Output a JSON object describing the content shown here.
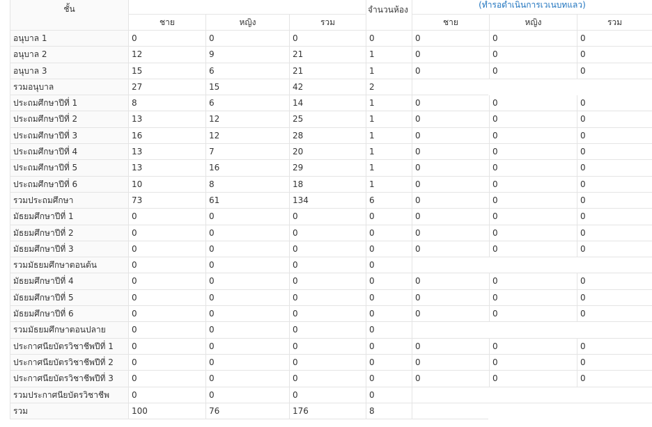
{
  "header": {
    "class_label": "ชั้น",
    "rooms_label": "จำนวนห้อง",
    "note": "(ทำรอดำเนินการเวเนบทแลว)",
    "students_cols": [
      "ชาย",
      "หญิง",
      "รวม"
    ],
    "waiting_cols": [
      "ชาย",
      "หญิง",
      "รวม"
    ]
  },
  "rows": [
    {
      "label": "อนุบาล 1",
      "m": "0",
      "f": "0",
      "t": "0",
      "rooms": "0",
      "w": [
        "0",
        "0",
        "0"
      ]
    },
    {
      "label": "อนุบาล 2",
      "m": "12",
      "f": "9",
      "t": "21",
      "rooms": "1",
      "w": [
        "0",
        "0",
        "0"
      ]
    },
    {
      "label": "อนุบาล 3",
      "m": "15",
      "f": "6",
      "t": "21",
      "rooms": "1",
      "w": [
        "0",
        "0",
        "0"
      ]
    },
    {
      "label": "รวมอนุบาล",
      "m": "27",
      "f": "15",
      "t": "42",
      "rooms": "2",
      "w": null
    },
    {
      "label": "ประถมศึกษาปีที่ 1",
      "m": "8",
      "f": "6",
      "t": "14",
      "rooms": "1",
      "w": [
        "0",
        "0",
        "0"
      ]
    },
    {
      "label": "ประถมศึกษาปีที่ 2",
      "m": "13",
      "f": "12",
      "t": "25",
      "rooms": "1",
      "w": [
        "0",
        "0",
        "0"
      ]
    },
    {
      "label": "ประถมศึกษาปีที่ 3",
      "m": "16",
      "f": "12",
      "t": "28",
      "rooms": "1",
      "w": [
        "0",
        "0",
        "0"
      ]
    },
    {
      "label": "ประถมศึกษาปีที่ 4",
      "m": "13",
      "f": "7",
      "t": "20",
      "rooms": "1",
      "w": [
        "0",
        "0",
        "0"
      ]
    },
    {
      "label": "ประถมศึกษาปีที่ 5",
      "m": "13",
      "f": "16",
      "t": "29",
      "rooms": "1",
      "w": [
        "0",
        "0",
        "0"
      ]
    },
    {
      "label": "ประถมศึกษาปีที่ 6",
      "m": "10",
      "f": "8",
      "t": "18",
      "rooms": "1",
      "w": [
        "0",
        "0",
        "0"
      ]
    },
    {
      "label": "รวมประถมศึกษา",
      "m": "73",
      "f": "61",
      "t": "134",
      "rooms": "6",
      "w": [
        "0",
        "0",
        "0"
      ]
    },
    {
      "label": "มัธยมศึกษาปีที่ 1",
      "m": "0",
      "f": "0",
      "t": "0",
      "rooms": "0",
      "w": [
        "0",
        "0",
        "0"
      ]
    },
    {
      "label": "มัธยมศึกษาปีที่ 2",
      "m": "0",
      "f": "0",
      "t": "0",
      "rooms": "0",
      "w": [
        "0",
        "0",
        "0"
      ]
    },
    {
      "label": "มัธยมศึกษาปีที่ 3",
      "m": "0",
      "f": "0",
      "t": "0",
      "rooms": "0",
      "w": [
        "0",
        "0",
        "0"
      ]
    },
    {
      "label": "รวมมัธยมศึกษาตอนต้น",
      "m": "0",
      "f": "0",
      "t": "0",
      "rooms": "0",
      "w": null
    },
    {
      "label": "มัธยมศึกษาปีที่ 4",
      "m": "0",
      "f": "0",
      "t": "0",
      "rooms": "0",
      "w": [
        "0",
        "0",
        "0"
      ]
    },
    {
      "label": "มัธยมศึกษาปีที่ 5",
      "m": "0",
      "f": "0",
      "t": "0",
      "rooms": "0",
      "w": [
        "0",
        "0",
        "0"
      ]
    },
    {
      "label": "มัธยมศึกษาปีที่ 6",
      "m": "0",
      "f": "0",
      "t": "0",
      "rooms": "0",
      "w": [
        "0",
        "0",
        "0"
      ]
    },
    {
      "label": "รวมมัธยมศึกษาตอนปลาย",
      "m": "0",
      "f": "0",
      "t": "0",
      "rooms": "0",
      "w": null
    },
    {
      "label": "ประกาศนียบัตรวิชาชีพปีที่ 1",
      "m": "0",
      "f": "0",
      "t": "0",
      "rooms": "0",
      "w": [
        "0",
        "0",
        "0"
      ]
    },
    {
      "label": "ประกาศนียบัตรวิชาชีพปีที่ 2",
      "m": "0",
      "f": "0",
      "t": "0",
      "rooms": "0",
      "w": [
        "0",
        "0",
        "0"
      ]
    },
    {
      "label": "ประกาศนียบัตรวิชาชีพปีที่ 3",
      "m": "0",
      "f": "0",
      "t": "0",
      "rooms": "0",
      "w": [
        "0",
        "0",
        "0"
      ]
    },
    {
      "label": "รวมประกาศนียบัตรวิชาชีพ",
      "m": "0",
      "f": "0",
      "t": "0",
      "rooms": "0",
      "w": null
    },
    {
      "label": "รวม",
      "m": "100",
      "f": "76",
      "t": "176",
      "rooms": "8",
      "w": null
    }
  ]
}
